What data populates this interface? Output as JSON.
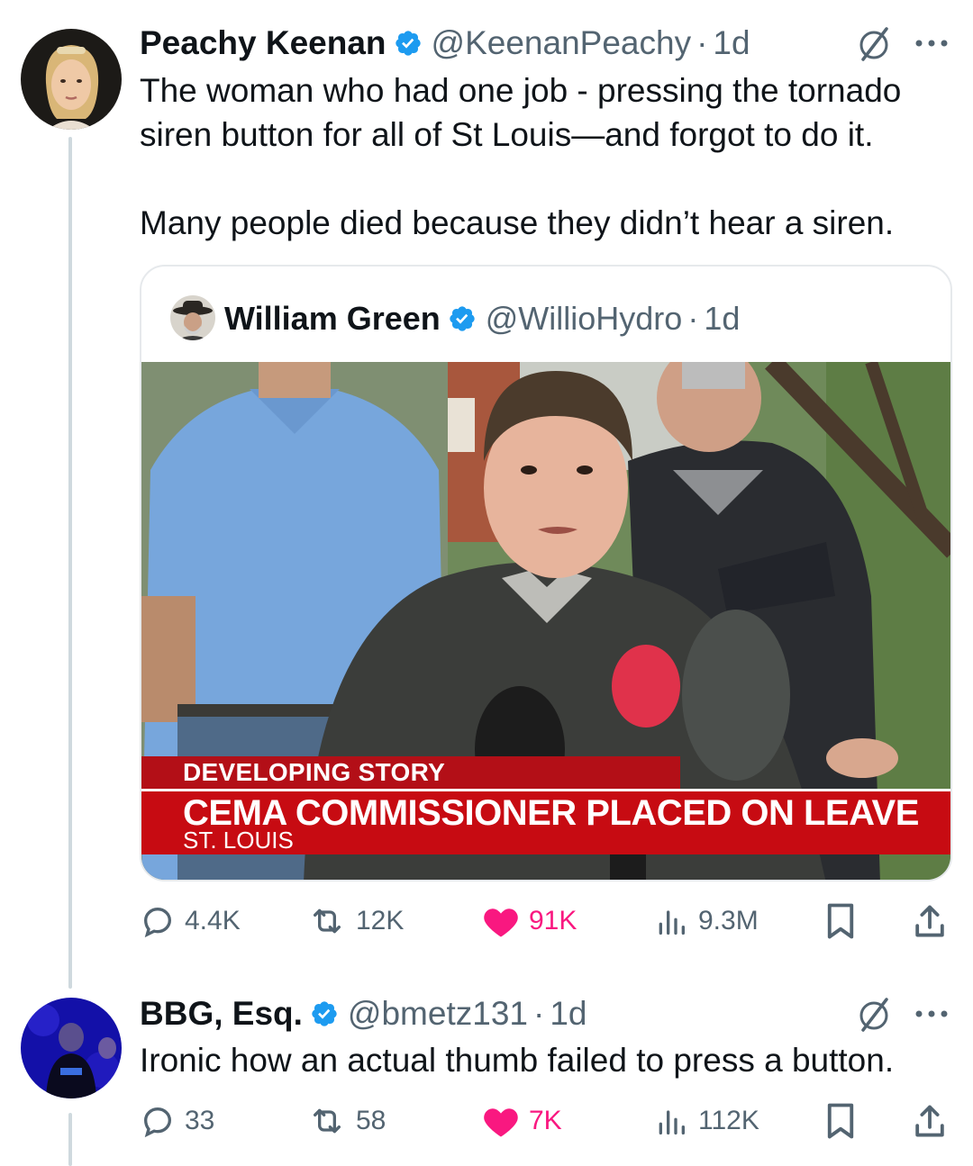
{
  "tweets": [
    {
      "author": {
        "name": "Peachy Keenan",
        "handle": "@KeenanPeachy",
        "time": "1d",
        "verified": true
      },
      "text_lines": [
        "The woman who had one job - pressing the tornado",
        "siren button for all of St Louis—and forgot to do it.",
        "",
        "Many people died because they didn’t hear a siren."
      ],
      "quote": {
        "author": {
          "name": "William Green",
          "handle": "@WillioHydro",
          "time": "1d",
          "verified": true
        },
        "media": {
          "chyron_tag": "DEVELOPING STORY",
          "chyron_headline": "CEMA COMMISSIONER PLACED ON LEAVE",
          "chyron_location": "ST. LOUIS"
        }
      },
      "stats": {
        "replies": "4.4K",
        "reposts": "12K",
        "likes": "91K",
        "views": "9.3M"
      }
    },
    {
      "author": {
        "name": "BBG, Esq.",
        "handle": "@bmetz131",
        "time": "1d",
        "verified": true
      },
      "text_lines": [
        "Ironic how an actual thumb failed to press a button."
      ],
      "stats": {
        "replies": "33",
        "reposts": "58",
        "likes": "7K",
        "views": "112K"
      }
    }
  ],
  "colors": {
    "verified_blue": "#1d9bf0",
    "like_pink": "#f91880",
    "muted_text": "#536471",
    "chyron_red": "#c70b12"
  },
  "icons": [
    "verified-badge-icon",
    "grok-icon",
    "more-icon",
    "reply-icon",
    "repost-icon",
    "like-icon",
    "views-icon",
    "bookmark-icon",
    "share-icon"
  ]
}
